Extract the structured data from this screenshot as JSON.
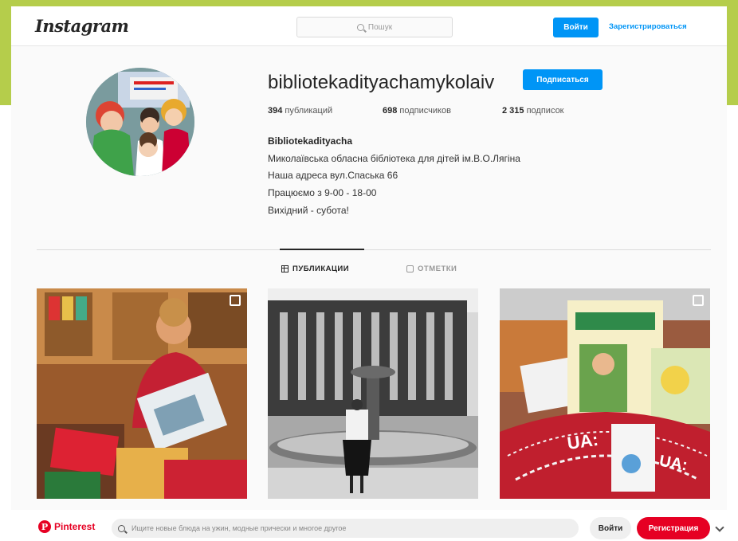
{
  "header": {
    "logo": "Instagram",
    "search_placeholder": "Пошук",
    "login_button": "Войти",
    "register_link": "Зарегистрироваться"
  },
  "profile": {
    "username": "bibliotekadityachamykolaiv",
    "follow_button": "Подписаться",
    "stats": {
      "posts_count": "394",
      "posts_label": "публикаций",
      "followers_count": "698",
      "followers_label": "подписчиков",
      "following_count": "2 315",
      "following_label": "подписок"
    },
    "bio": {
      "name": "Bibliotekadityacha",
      "lines": [
        "Миколаївська обласна бібліотека для дітей ім.В.О.Лягіна",
        "Наша адреса вул.Спаська 66",
        "Працюємо з 9-00 - 18-00",
        "Вихідний - субота!"
      ]
    }
  },
  "tabs": [
    {
      "label": "ПУБЛИКАЦИИ",
      "icon": "grid-icon",
      "active": true
    },
    {
      "label": "ОТМЕТКИ",
      "icon": "tag-icon",
      "active": false
    }
  ],
  "posts": [
    {
      "subject": "child reading books"
    },
    {
      "subject": "vintage photo of woman by fountain"
    },
    {
      "subject": "children's books on radio UA table"
    }
  ],
  "pinterest": {
    "logo": "Pinterest",
    "search_placeholder": "Ищите новые блюда на ужин, модные прически и многое другое",
    "login_button": "Войти",
    "register_button": "Регистрация"
  },
  "colors": {
    "frame": "#b5cd4b",
    "ig_blue": "#0095f6",
    "pinterest_red": "#e60023"
  }
}
